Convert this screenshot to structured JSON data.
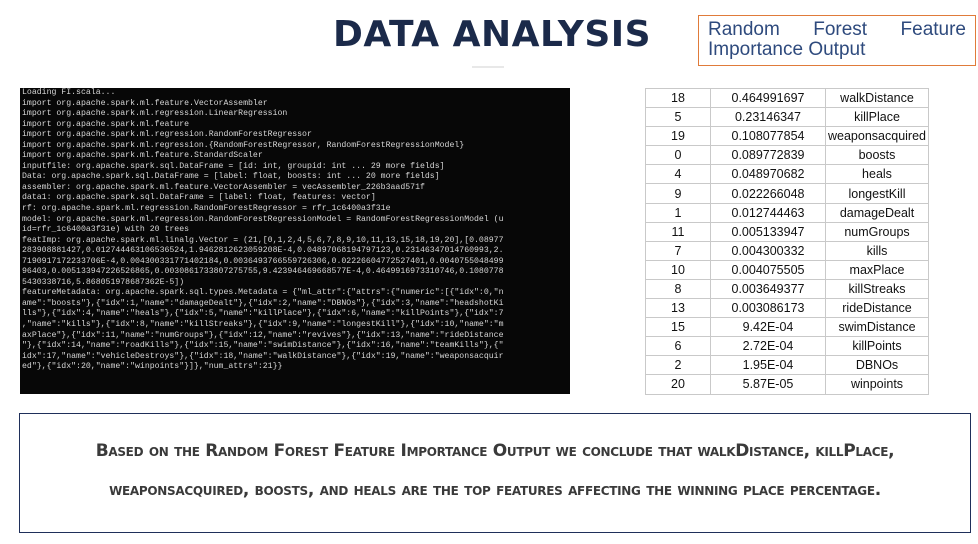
{
  "title": "DATA ANALYSIS",
  "callout": "Random Forest Feature Importance Output",
  "console_lines": [
    "Loading FI.scala...",
    "import org.apache.spark.ml.feature.VectorAssembler",
    "import org.apache.spark.ml.regression.LinearRegression",
    "import org.apache.spark.ml.feature",
    "import org.apache.spark.ml.regression.RandomForestRegressor",
    "import org.apache.spark.ml.regression.{RandomForestRegressor, RandomForestRegressionModel}",
    "import org.apache.spark.ml.feature.StandardScaler",
    "inputfile: org.apache.spark.sql.DataFrame = [id: int, groupid: int ... 29 more fields]",
    "Data: org.apache.spark.sql.DataFrame = [label: float, boosts: int ... 20 more fields]",
    "assembler: org.apache.spark.ml.feature.VectorAssembler = vecAssembler_226b3aad571f",
    "data1: org.apache.spark.sql.DataFrame = [label: float, features: vector]",
    "rf: org.apache.spark.ml.regression.RandomForestRegressor = rfr_1c6400a3f31e",
    "model: org.apache.spark.ml.regression.RandomForestRegressionModel = RandomForestRegressionModel (u",
    "id=rfr_1c6400a3f31e) with 20 trees",
    "featImp: org.apache.spark.ml.linalg.Vector = (21,[0,1,2,4,5,6,7,8,9,10,11,13,15,18,19,20],[0.08977",
    "283908881427,0.012744463106536524,1.9462812623059208E-4,0.04897068194797123,0.23146347014760993,2.",
    "7190917172233706E-4,0.004300331771402184,0.0036493766559726306,0.02226604772527401,0.0040755048499",
    "96403,0.005133947226526865,0.0030861733807275755,9.423946469668577E-4,0.4649916973310746,0.1080778",
    "5430338716,5.868051978687362E-5])",
    "featureMetadata: org.apache.spark.sql.types.Metadata = {\"ml_attr\":{\"attrs\":{\"numeric\":[{\"idx\":0,\"n",
    "ame\":\"boosts\"},{\"idx\":1,\"name\":\"damageDealt\"},{\"idx\":2,\"name\":\"DBNOs\"},{\"idx\":3,\"name\":\"headshotKi",
    "lls\"},{\"idx\":4,\"name\":\"heals\"},{\"idx\":5,\"name\":\"killPlace\"},{\"idx\":6,\"name\":\"killPoints\"},{\"idx\":7",
    ",\"name\":\"kills\"},{\"idx\":8,\"name\":\"killStreaks\"},{\"idx\":9,\"name\":\"longestKill\"},{\"idx\":10,\"name\":\"m",
    "axPlace\"},{\"idx\":11,\"name\":\"numGroups\"},{\"idx\":12,\"name\":\"revives\"},{\"idx\":13,\"name\":\"rideDistance",
    "\"},{\"idx\":14,\"name\":\"roadKills\"},{\"idx\":15,\"name\":\"swimDistance\"},{\"idx\":16,\"name\":\"teamKills\"},{\"",
    "idx\":17,\"name\":\"vehicleDestroys\"},{\"idx\":18,\"name\":\"walkDistance\"},{\"idx\":19,\"name\":\"weaponsacquir",
    "ed\"},{\"idx\":20,\"name\":\"winpoints\"}]},\"num_attrs\":21}}"
  ],
  "importance_table": [
    {
      "idx": "18",
      "value": "0.464991697",
      "name": "walkDistance"
    },
    {
      "idx": "5",
      "value": "0.23146347",
      "name": "killPlace"
    },
    {
      "idx": "19",
      "value": "0.108077854",
      "name": "weaponsacquired"
    },
    {
      "idx": "0",
      "value": "0.089772839",
      "name": "boosts"
    },
    {
      "idx": "4",
      "value": "0.048970682",
      "name": "heals"
    },
    {
      "idx": "9",
      "value": "0.022266048",
      "name": "longestKill"
    },
    {
      "idx": "1",
      "value": "0.012744463",
      "name": "damageDealt"
    },
    {
      "idx": "11",
      "value": "0.005133947",
      "name": "numGroups"
    },
    {
      "idx": "7",
      "value": "0.004300332",
      "name": "kills"
    },
    {
      "idx": "10",
      "value": "0.004075505",
      "name": "maxPlace"
    },
    {
      "idx": "8",
      "value": "0.003649377",
      "name": "killStreaks"
    },
    {
      "idx": "13",
      "value": "0.003086173",
      "name": "rideDistance"
    },
    {
      "idx": "15",
      "value": "9.42E-04",
      "name": "swimDistance"
    },
    {
      "idx": "6",
      "value": "2.72E-04",
      "name": "killPoints"
    },
    {
      "idx": "2",
      "value": "1.95E-04",
      "name": "DBNOs"
    },
    {
      "idx": "20",
      "value": "5.87E-05",
      "name": "winpoints"
    }
  ],
  "conclusion": {
    "line1": "Based on the Random Forest Feature Importance Output we conclude that walkDistance, killPlace,",
    "line2": "weaponsacquired, boosts, and heals are the top features affecting the winning place percentage."
  },
  "colors": {
    "title": "#1b2a4a",
    "callout_border": "#e07b3a",
    "callout_text": "#2e4a7d",
    "console_bg": "#070707",
    "conclusion_border": "#1f2f5a"
  }
}
